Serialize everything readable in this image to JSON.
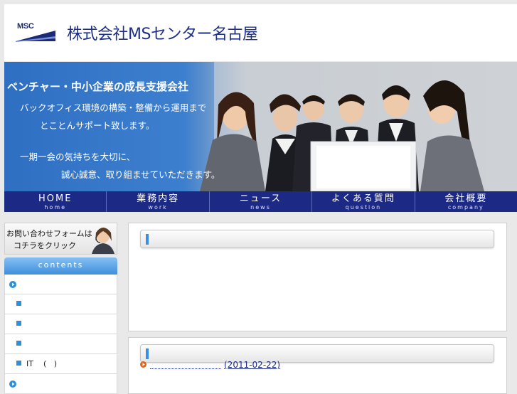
{
  "header": {
    "logo_text": "MSC",
    "company_name": "株式会社MSセンター名古屋"
  },
  "hero": {
    "title": "ベンチャー・中小企業の成長支援会社",
    "line1": "バックオフィス環境の構築・整備から運用まで",
    "line2": "とことんサポート致します。",
    "line3": "一期一会の気持ちを大切に、",
    "line4": "誠心誠意、取り組ませていただきます。"
  },
  "nav": {
    "items": [
      {
        "label": "HOME",
        "sub": "home"
      },
      {
        "label": "業務内容",
        "sub": "work"
      },
      {
        "label": "ニュース",
        "sub": "news"
      },
      {
        "label": "よくある質問",
        "sub": "question"
      },
      {
        "label": "会社概要",
        "sub": "company"
      }
    ]
  },
  "sidebar": {
    "contact_line1": "お問い合わせフォームは",
    "contact_line2": "コチラをクリック",
    "contents_label": "contents",
    "items": [
      {
        "label": "",
        "icon": "circle-arrow-icon"
      },
      {
        "label": "",
        "icon": "square-bullet-icon"
      },
      {
        "label": "",
        "icon": "square-bullet-icon"
      },
      {
        "label": "",
        "icon": "square-bullet-icon"
      },
      {
        "label": "IT    (   )",
        "icon": "square-bullet-icon"
      },
      {
        "label": "",
        "icon": "circle-arrow-icon"
      }
    ]
  },
  "main": {
    "news": {
      "date": "(2011-02-22)"
    }
  },
  "colors": {
    "navy": "#1c2a86",
    "accent_blue": "#3b8ee0",
    "contents_blue": "#4c97e0",
    "bullet_orange": "#e0641e"
  }
}
